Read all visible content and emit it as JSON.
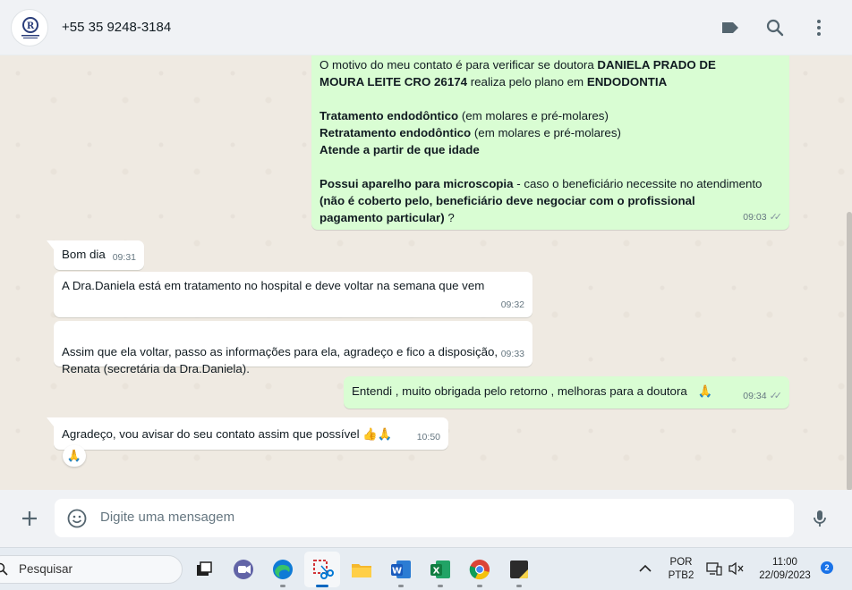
{
  "header": {
    "contact_name": "+55 35 9248-3184",
    "icons": [
      "label-icon",
      "search-icon",
      "menu-icon"
    ]
  },
  "messages": [
    {
      "direction": "outgoing",
      "lines": [
        [
          {
            "t": "O motivo do meu contato é para verificar se  doutora "
          },
          {
            "t": "DANIELA PRADO DE",
            "b": true
          }
        ],
        [
          {
            "t": "MOURA LEITE  CRO 26174",
            "b": true
          },
          {
            "t": " realiza pelo plano em "
          },
          {
            "t": "ENDODONTIA",
            "b": true
          }
        ],
        [],
        [
          {
            "t": "Tratamento endodôntico",
            "b": true
          },
          {
            "t": " (em molares e pré-molares)"
          }
        ],
        [
          {
            "t": "Retratamento endodôntico",
            "b": true
          },
          {
            "t": " (em molares e pré-molares)"
          }
        ],
        [
          {
            "t": "Atende a partir de que idade",
            "b": true
          }
        ],
        [],
        [
          {
            "t": "Possui aparelho para microscopia",
            "b": true
          },
          {
            "t": " - caso o beneficiário necessite no atendimento"
          }
        ],
        [
          {
            "t": "(não é coberto pelo, beneficiário deve negociar com o profissional",
            "b": true
          }
        ],
        [
          {
            "t": "pagamento particular)",
            "b": true
          },
          {
            "t": "  ?"
          }
        ]
      ],
      "time": "09:03",
      "status": "read"
    },
    {
      "direction": "incoming",
      "text": "Bom dia",
      "time": "09:31"
    },
    {
      "direction": "incoming",
      "text": "A Dra.Daniela está em tratamento no hospital e deve voltar na semana que vem",
      "time": "09:32"
    },
    {
      "direction": "incoming",
      "text": "Assim que ela voltar, passo as informações para ela, agradeço e fico a disposição,\nRenata (secretária da Dra.Daniela).",
      "time": "09:33"
    },
    {
      "direction": "outgoing",
      "text": "Entendi , muito obrigada pelo retorno , melhoras para a doutora",
      "emoji": "🙏",
      "time": "09:34",
      "status": "read"
    },
    {
      "direction": "incoming",
      "text": "Agradeço, vou avisar do seu contato assim que possível",
      "emoji": "👍🙏",
      "time": "10:50",
      "reaction": "🙏"
    }
  ],
  "composer": {
    "placeholder": "Digite uma mensagem",
    "icons": [
      "plus-icon",
      "emoji-icon",
      "mic-icon"
    ]
  },
  "taskbar": {
    "search_placeholder": "Pesquisar",
    "apps": [
      "task-view",
      "teams",
      "edge",
      "snipping-tool",
      "file-explorer",
      "word",
      "excel",
      "chrome",
      "sticky-notes"
    ],
    "language_line1": "POR",
    "language_line2": "PTB2",
    "time": "11:00",
    "date": "22/09/2023",
    "notification_count": "2"
  },
  "colors": {
    "outgoing_bubble": "#d9fdd3",
    "incoming_bubble": "#ffffff",
    "chat_background": "#efeae2",
    "header_background": "#f0f2f5",
    "read_ticks": "#8696a0"
  }
}
